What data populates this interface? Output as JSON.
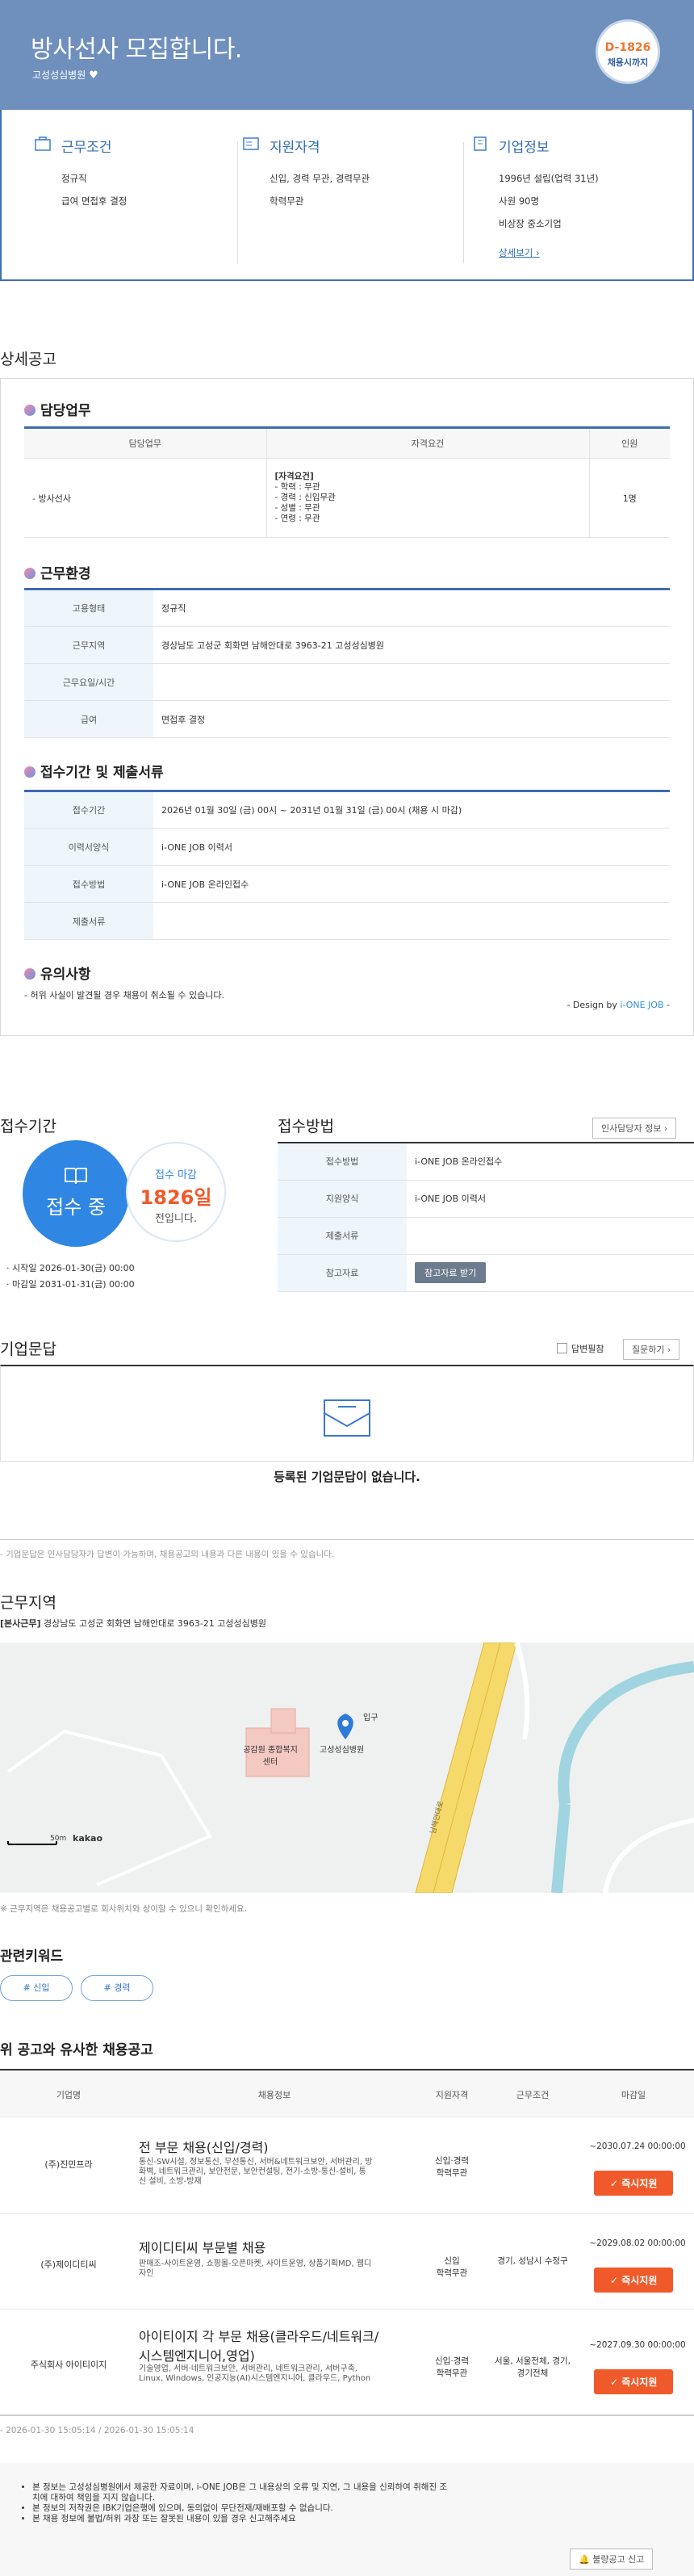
{
  "header": {
    "title": "방사선사 모집합니다.",
    "company": "고성성심병원",
    "dday": "D-1826",
    "dday_label": "채용시까지"
  },
  "summary": {
    "work": {
      "title": "근무조건",
      "lines": [
        "정규직",
        "급여 면접후 결정"
      ]
    },
    "qual": {
      "title": "지원자격",
      "lines": [
        "신입, 경력 무관, 경력무관",
        "학력무관"
      ]
    },
    "company": {
      "title": "기업정보",
      "lines": [
        "1996년 설립(업력 31년)",
        "사원 90명",
        "비상장 중소기업"
      ],
      "link": "상세보기"
    }
  },
  "detail": {
    "title": "상세공고",
    "duty": {
      "title": "담당업무",
      "headers": [
        "담당업무",
        "자격요건",
        "인원"
      ],
      "row": {
        "task": "- 방사선사",
        "req_title": "[자격요건]",
        "req": [
          "- 학력 : 무관",
          "- 경력 : 신입무관",
          "- 성별 : 무관",
          "- 연령 : 무관"
        ],
        "count": "1명"
      }
    },
    "env": {
      "title": "근무환경",
      "rows": [
        {
          "k": "고용형태",
          "v": "정규직"
        },
        {
          "k": "근무지역",
          "v": "경상남도 고성군 회화면 남해안대로 3963-21 고성성심병원"
        },
        {
          "k": "근무요일/시간",
          "v": ""
        },
        {
          "k": "급여",
          "v": "면접후 결정"
        }
      ]
    },
    "apply": {
      "title": "접수기간 및 제출서류",
      "rows": [
        {
          "k": "접수기간",
          "v": "2026년 01월 30일 (금) 00시 ~ 2031년 01월 31일 (금) 00시 (채용 시 마감)"
        },
        {
          "k": "이력서양식",
          "v": "i-ONE JOB 이력서"
        },
        {
          "k": "접수방법",
          "v": "i-ONE JOB 온라인접수"
        },
        {
          "k": "제출서류",
          "v": ""
        }
      ]
    },
    "notice": {
      "title": "유의사항",
      "text": "- 허위 사실이 발견될 경우 채용이 취소될 수 있습니다.",
      "design": "- Design by",
      "brand": "i-ONE JOB",
      "design_end": "-"
    }
  },
  "period": {
    "title": "접수기간",
    "status": "접수 중",
    "deadline_label": "접수 마감",
    "days": "1826일",
    "days_suffix": "전입니다.",
    "start": "· 시작일 2026-01-30(금) 00:00",
    "end": "· 마감일 2031-01-31(금) 00:00"
  },
  "method": {
    "title": "접수방법",
    "contact_btn": "인사담당자 정보",
    "rows": [
      {
        "k": "접수방법",
        "v": "i-ONE JOB 온라인접수"
      },
      {
        "k": "지원양식",
        "v": "i-ONE JOB 이력서"
      },
      {
        "k": "제출서류",
        "v": ""
      },
      {
        "k": "참고자료",
        "v": "참고자료 받기"
      }
    ]
  },
  "qna": {
    "title": "기업문답",
    "checkbox": "답변필참",
    "ask_btn": "질문하기",
    "empty": "등록된 기업문답이 없습니다.",
    "note": "- 기업문답은 인사담당자가 답변이 가능하며, 채용공고의 내용과 다른 내용이 있을 수 있습니다."
  },
  "location": {
    "title": "근무지역",
    "tag": "[본사근무]",
    "addr": "경상남도 고성군 회화면 남해안대로 3963-21 고성성심병원",
    "map_labels": {
      "hospital": "고성성심병원",
      "center": "공감원 종합복지센터",
      "side": "입구",
      "road": "남해안대로",
      "scale": "50m",
      "brand": "kakao"
    },
    "note": "※ 근무지역은 채용공고별로 회사위치와 상이할 수 있으니 확인하세요."
  },
  "keywords": {
    "title": "관련키워드",
    "items": [
      "# 신입",
      "# 경력"
    ]
  },
  "similar": {
    "title": "위 공고와 유사한 채용공고",
    "headers": [
      "기업명",
      "채용정보",
      "지원자격",
      "근무조건",
      "마감일"
    ],
    "apply_label": "✓ 즉시지원",
    "rows": [
      {
        "company": "(주)진민프라",
        "title": "전 부문 채용(신입/경력)",
        "desc": "통신-SW시설, 정보통신, 무선통신, 서버&네트워크보안, 서버관리, 방화벽, 네트워크관리, 보안전문, 보안컨설팅, 전기-소방-통신-설비, 통신 설비, 소방-방재",
        "qual": "신입·경력\n학력무관",
        "cond": "",
        "date": "~2030.07.24 00:00:00"
      },
      {
        "company": "(주)제이디티씨",
        "title": "제이디티씨 부문별 채용",
        "desc": "판매조-사이트운영, 쇼핑몰-오픈마켓, 사이트운영, 상품기획MD, 웹디자인",
        "qual": "신입\n학력무관",
        "cond": "경기, 성남시 수정구",
        "date": "~2029.08.02 00:00:00"
      },
      {
        "company": "주식회사 아이티이지",
        "title": "아이티이지 각 부문 채용(클라우드/네트워크/시스템엔지니어,영업)",
        "desc": "기술영업, 서버·네트워크보안, 서버관리, 네트워크관리, 서버구축, Linux, Windows, 인공지능(AI)시스템엔지니어, 클라우드, Python",
        "qual": "신입·경력\n학력무관",
        "cond": "서울, 서울전체, 경기, 경기전체",
        "date": "~2027.09.30 00:00:00"
      }
    ]
  },
  "dates": "- 2026-01-30 15:05:14 / 2026-01-30 15:05:14",
  "footer": {
    "lines": [
      "본 정보는 고성성심병원에서 제공한 자료이며, i-ONE JOB은 그 내용상의 오류 및 지연, 그 내용을 신뢰하여 취해진 조치에 대하여 책임을 지지 않습니다.",
      "본 정보의 저작권은 IBK기업은행에 있으며, 동의없이 무단전재/재배포할 수 없습니다.",
      "본 채용 정보에 불법/허위 과장 또는 잘못된 내용이 있을 경우 신고해주세요"
    ],
    "report_btn": "불량공고 신고"
  },
  "colors": {
    "hero": "#6f8fbd",
    "accent": "#3e6bb0",
    "orange": "#f05a2a",
    "period_blue": "#2f86e3"
  }
}
